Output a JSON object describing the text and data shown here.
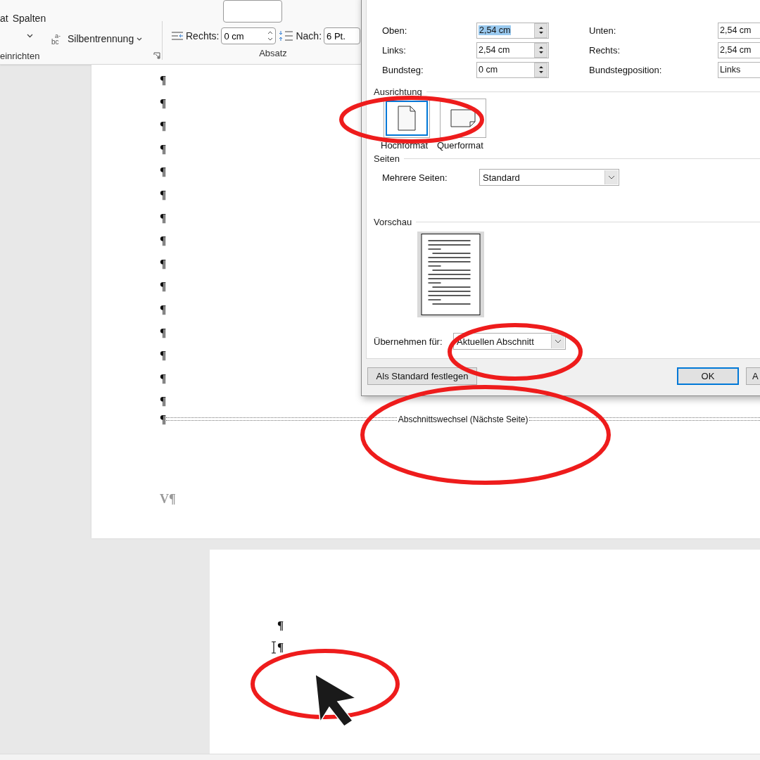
{
  "ribbon": {
    "layout_group": {
      "label": "einrichten",
      "cut_button": "at",
      "columns_button": "Spalten",
      "hyphenation_button": "Silbentrennung",
      "hyphenation_icon_top": "a-",
      "hyphenation_icon_bottom": "bc"
    },
    "paragraph_group": {
      "label": "Absatz",
      "indent_right_label": "Rechts:",
      "indent_right_value": "0 cm",
      "spacing_after_label": "Nach:",
      "spacing_after_value": "6 Pt."
    }
  },
  "dialog": {
    "margins": [
      {
        "label": "Oben:",
        "value": "2,54 cm",
        "kind": "spin",
        "highlighted": true
      },
      {
        "label": "Unten:",
        "value": "2,54 cm",
        "kind": "spin",
        "highlighted": false
      },
      {
        "label": "Links:",
        "value": "2,54 cm",
        "kind": "spin",
        "highlighted": false
      },
      {
        "label": "Rechts:",
        "value": "2,54 cm",
        "kind": "spin",
        "highlighted": false
      },
      {
        "label": "Bundsteg:",
        "value": "0 cm",
        "kind": "spin",
        "highlighted": false
      },
      {
        "label": "Bundstegposition:",
        "value": "Links",
        "kind": "select",
        "highlighted": false
      }
    ],
    "orientation": {
      "heading": "Ausrichtung",
      "options": [
        {
          "label": "Hochformat",
          "kind": "portrait",
          "selected": true
        },
        {
          "label": "Querformat",
          "kind": "landscape",
          "selected": false
        }
      ]
    },
    "pages": {
      "heading": "Seiten",
      "label": "Mehrere Seiten:",
      "value": "Standard"
    },
    "preview": {
      "heading": "Vorschau"
    },
    "apply": {
      "label": "Übernehmen für:",
      "value": "Aktuellen Abschnitt"
    },
    "buttons": [
      {
        "label": "Als Standard festlegen",
        "default": false
      },
      {
        "label": "OK",
        "default": true
      },
      {
        "label": "A",
        "default": false
      }
    ]
  },
  "document": {
    "page1_marks": [
      "¶",
      "¶",
      "¶",
      "¶",
      "¶",
      "¶",
      "¶",
      "¶",
      "¶",
      "¶",
      "¶",
      "¶",
      "¶",
      "¶",
      "¶"
    ],
    "section_break": {
      "mark": "¶",
      "label": "Abschnittswechsel (Nächste Seite)"
    },
    "footer_text": "V¶",
    "page2_marks": [
      "¶",
      "¶"
    ]
  }
}
